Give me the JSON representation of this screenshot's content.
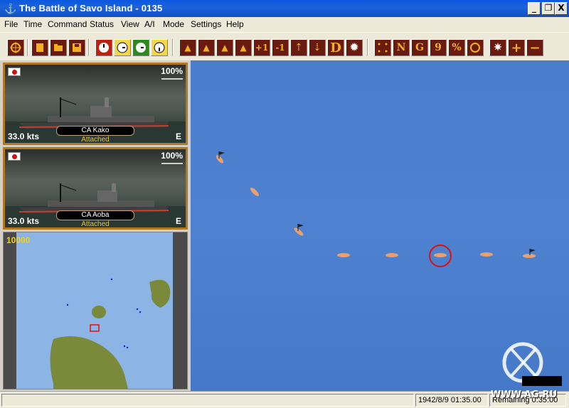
{
  "window": {
    "title": "The Battle of Savo Island - 0135",
    "minimize": "_",
    "restore": "❐",
    "close": "X"
  },
  "menu": [
    "File",
    "Time",
    "Command",
    "Status",
    "View",
    "A/I",
    "Mode",
    "Settings",
    "Help"
  ],
  "toolbar": {
    "letter_buttons": [
      "D",
      "N",
      "G",
      "9",
      "%"
    ],
    "plus": "+",
    "minus": "−",
    "one_up": "+1",
    "one_down": "-1"
  },
  "ships": [
    {
      "name": "CA Kako",
      "status": "Attached",
      "speed": "33.0 kts",
      "heading": "E",
      "integrity": "100%"
    },
    {
      "name": "CA Aoba",
      "status": "Attached",
      "speed": "33.0 kts",
      "heading": "E",
      "integrity": "100%"
    }
  ],
  "minimap": {
    "scale": "10000"
  },
  "statusbar": {
    "datetime": "1942/8/9 01:35.00",
    "remaining": "Remaining 0:35:00"
  },
  "watermark": "WWW.AG.RU",
  "colors": {
    "sea": "#4a7ecc",
    "ship": "#e8a070",
    "selection": "#e01010",
    "flag": "#222222",
    "panel_border": "#b07820"
  }
}
